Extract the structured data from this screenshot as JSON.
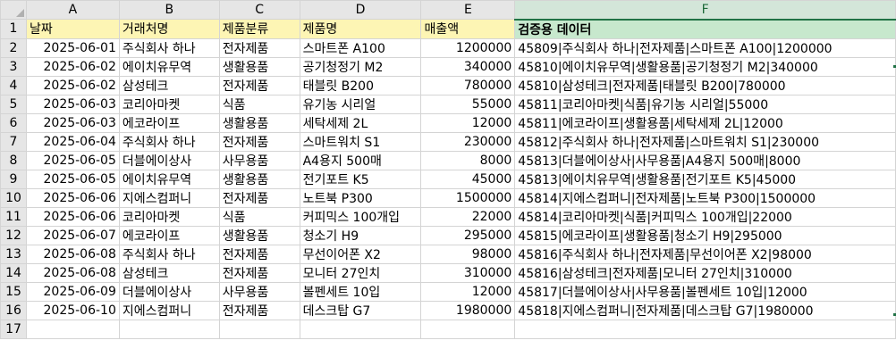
{
  "columns": [
    "A",
    "B",
    "C",
    "D",
    "E",
    "F"
  ],
  "header": {
    "row": "1",
    "date": "날짜",
    "customer": "거래처명",
    "category": "제품분류",
    "product": "제품명",
    "sales": "매출액",
    "verify": "검증용 데이터"
  },
  "rows": [
    {
      "row": "2",
      "date": "2025-06-01",
      "customer": "주식회사 하나",
      "category": "전자제품",
      "product": "스마트폰 A100",
      "sales": "1200000",
      "verify": "45809|주식회사 하나|전자제품|스마트폰 A100|1200000"
    },
    {
      "row": "3",
      "date": "2025-06-02",
      "customer": "에이치유무역",
      "category": "생활용품",
      "product": "공기청정기 M2",
      "sales": "340000",
      "verify": "45810|에이치유무역|생활용품|공기청정기 M2|340000"
    },
    {
      "row": "4",
      "date": "2025-06-02",
      "customer": "삼성테크",
      "category": "전자제품",
      "product": "태블릿 B200",
      "sales": "780000",
      "verify": "45810|삼성테크|전자제품|태블릿 B200|780000"
    },
    {
      "row": "5",
      "date": "2025-06-03",
      "customer": "코리아마켓",
      "category": "식품",
      "product": "유기농 시리얼",
      "sales": "55000",
      "verify": "45811|코리아마켓|식품|유기농 시리얼|55000"
    },
    {
      "row": "6",
      "date": "2025-06-03",
      "customer": "에코라이프",
      "category": "생활용품",
      "product": "세탁세제 2L",
      "sales": "12000",
      "verify": "45811|에코라이프|생활용품|세탁세제 2L|12000"
    },
    {
      "row": "7",
      "date": "2025-06-04",
      "customer": "주식회사 하나",
      "category": "전자제품",
      "product": "스마트워치 S1",
      "sales": "230000",
      "verify": "45812|주식회사 하나|전자제품|스마트워치 S1|230000"
    },
    {
      "row": "8",
      "date": "2025-06-05",
      "customer": "더블에이상사",
      "category": "사무용품",
      "product": "A4용지 500매",
      "sales": "8000",
      "verify": "45813|더블에이상사|사무용품|A4용지 500매|8000"
    },
    {
      "row": "9",
      "date": "2025-06-05",
      "customer": "에이치유무역",
      "category": "생활용품",
      "product": "전기포트 K5",
      "sales": "45000",
      "verify": "45813|에이치유무역|생활용품|전기포트 K5|45000"
    },
    {
      "row": "10",
      "date": "2025-06-06",
      "customer": "지에스컴퍼니",
      "category": "전자제품",
      "product": "노트북 P300",
      "sales": "1500000",
      "verify": "45814|지에스컴퍼니|전자제품|노트북 P300|1500000"
    },
    {
      "row": "11",
      "date": "2025-06-06",
      "customer": "코리아마켓",
      "category": "식품",
      "product": "커피믹스 100개입",
      "sales": "22000",
      "verify": "45814|코리아마켓|식품|커피믹스 100개입|22000"
    },
    {
      "row": "12",
      "date": "2025-06-07",
      "customer": "에코라이프",
      "category": "생활용품",
      "product": "청소기 H9",
      "sales": "295000",
      "verify": "45815|에코라이프|생활용품|청소기 H9|295000"
    },
    {
      "row": "13",
      "date": "2025-06-08",
      "customer": "주식회사 하나",
      "category": "전자제품",
      "product": "무선이어폰 X2",
      "sales": "98000",
      "verify": "45816|주식회사 하나|전자제품|무선이어폰 X2|98000"
    },
    {
      "row": "14",
      "date": "2025-06-08",
      "customer": "삼성테크",
      "category": "전자제품",
      "product": "모니터 27인치",
      "sales": "310000",
      "verify": "45816|삼성테크|전자제품|모니터 27인치|310000"
    },
    {
      "row": "15",
      "date": "2025-06-09",
      "customer": "더블에이상사",
      "category": "사무용품",
      "product": "볼펜세트 10입",
      "sales": "12000",
      "verify": "45817|더블에이상사|사무용품|볼펜세트 10입|12000"
    },
    {
      "row": "16",
      "date": "2025-06-10",
      "customer": "지에스컴퍼니",
      "category": "전자제품",
      "product": "데스크탑 G7",
      "sales": "1980000",
      "verify": "45818|지에스컴퍼니|전자제품|데스크탑 G7|1980000"
    },
    {
      "row": "17",
      "date": "",
      "customer": "",
      "category": "",
      "product": "",
      "sales": "",
      "verify": ""
    }
  ],
  "colors": {
    "header_yellow": "#fdf5b4",
    "header_green": "#c7e8cd",
    "selection_accent": "#217346"
  }
}
